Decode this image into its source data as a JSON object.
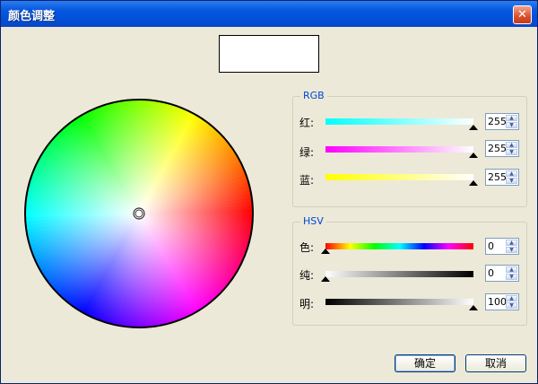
{
  "window": {
    "title": "颜色调整",
    "close_glyph": "✕",
    "close_icon": "close-icon"
  },
  "preview": {
    "color": "#ffffff"
  },
  "color_wheel": {
    "selected_hue": 0,
    "selected_saturation": 0,
    "selected_value": 100
  },
  "rgb": {
    "legend": "RGB",
    "rows": [
      {
        "label": "红:",
        "value": "255",
        "level": 255,
        "max": 255,
        "bar_from": "#00ffff",
        "bar_to": "#ffffff"
      },
      {
        "label": "绿:",
        "value": "255",
        "level": 255,
        "max": 255,
        "bar_from": "#ff00ff",
        "bar_to": "#ffffff"
      },
      {
        "label": "蓝:",
        "value": "255",
        "level": 255,
        "max": 255,
        "bar_from": "#ffff00",
        "bar_to": "#ffffff"
      }
    ]
  },
  "hsv": {
    "legend": "HSV",
    "rows": [
      {
        "label": "色:",
        "value": "0",
        "level": 0,
        "max": 360
      },
      {
        "label": "纯:",
        "value": "0",
        "level": 0,
        "max": 100
      },
      {
        "label": "明:",
        "value": "100",
        "level": 100,
        "max": 100
      }
    ]
  },
  "buttons": {
    "ok": "确定",
    "cancel": "取消"
  },
  "spin_up_glyph": "▲",
  "spin_down_glyph": "▼"
}
